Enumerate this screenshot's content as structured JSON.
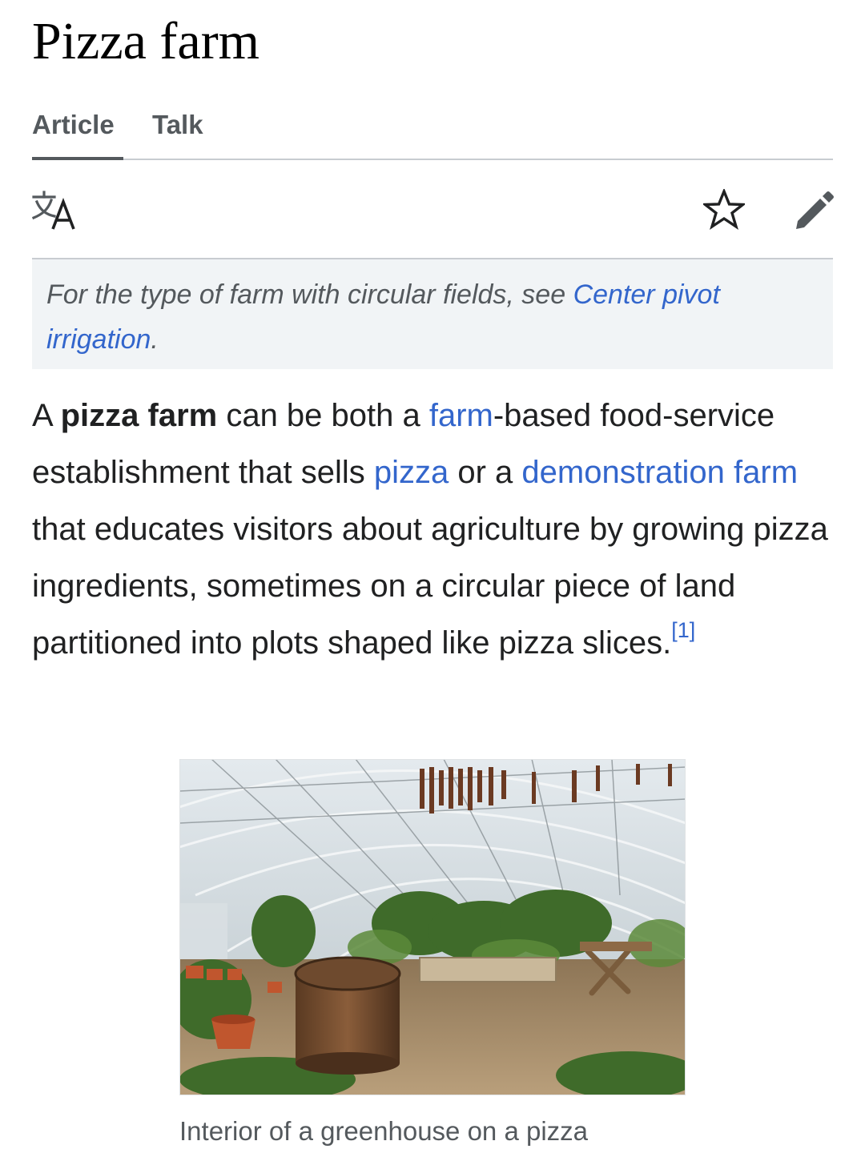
{
  "page": {
    "title": "Pizza farm"
  },
  "tabs": {
    "article": "Article",
    "talk": "Talk"
  },
  "toolbar": {
    "icons": [
      "language-icon",
      "star-icon",
      "edit-icon"
    ]
  },
  "hatnote": {
    "prefix": "For the type of farm with circular fields, see ",
    "link": "Center pivot irrigation",
    "suffix": "."
  },
  "lead": {
    "t1": "A ",
    "bold": "pizza farm",
    "t2": " can be both a ",
    "link_farm": "farm",
    "t3": "-based food-service establishment that sells ",
    "link_pizza": "pizza",
    "t4": " or a ",
    "link_demo": "demonstration farm",
    "t5": " that educates visitors about agriculture by growing pizza ingredients, sometimes on a circular piece of land partitioned into plots shaped like pizza slices.",
    "ref": "[1]"
  },
  "figure": {
    "caption": "Interior of a greenhouse on a pizza"
  },
  "colors": {
    "link": "#3366cc",
    "text": "#202122",
    "muted": "#54595d",
    "hatnote_bg": "#f1f4f6",
    "divider": "#c8ccd1"
  }
}
